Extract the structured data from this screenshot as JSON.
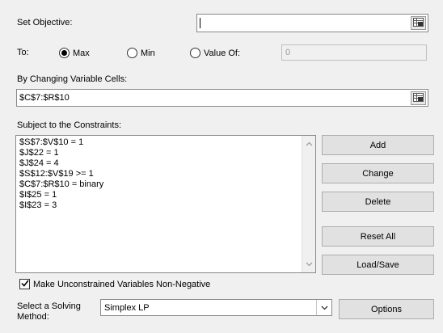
{
  "objective": {
    "label": "Set Objective:",
    "value": ""
  },
  "to": {
    "label": "To:",
    "options": [
      {
        "label": "Max",
        "selected": true
      },
      {
        "label": "Min",
        "selected": false
      },
      {
        "label": "Value Of:",
        "selected": false
      }
    ],
    "value_of": "0"
  },
  "changing": {
    "label": "By Changing Variable Cells:",
    "value": "$C$7:$R$10"
  },
  "constraints": {
    "label": "Subject to the Constraints:",
    "items": [
      "$S$7:$V$10 = 1",
      "$J$22 = 1",
      "$J$24 = 4",
      "$S$12:$V$19 >= 1",
      "$C$7:$R$10 = binary",
      "$I$25 = 1",
      "$I$23 = 3"
    ]
  },
  "buttons": {
    "add": "Add",
    "change": "Change",
    "delete": "Delete",
    "reset_all": "Reset All",
    "load_save": "Load/Save",
    "options": "Options"
  },
  "nonneg": {
    "label": "Make Unconstrained Variables Non-Negative",
    "checked": true
  },
  "method": {
    "label_line1": "Select a Solving",
    "label_line2": "Method:",
    "value": "Simplex LP"
  }
}
